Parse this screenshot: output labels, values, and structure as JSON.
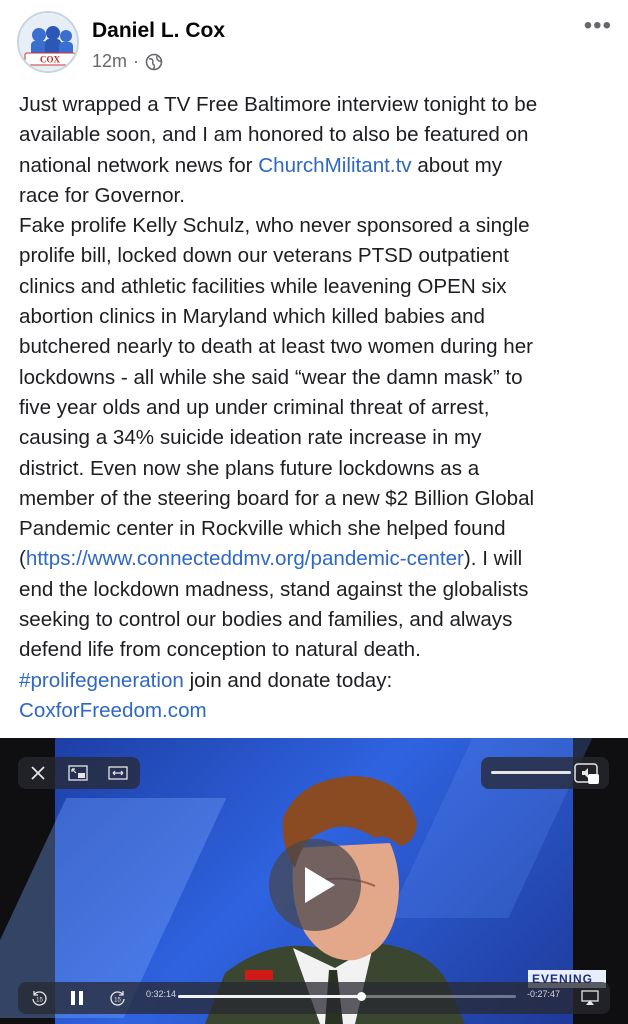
{
  "post": {
    "author": "Daniel L. Cox",
    "time": "12m",
    "visibility_icon": "globe-icon",
    "more_icon": "more-options-icon",
    "avatar_label": "COX",
    "lines": [
      [
        {
          "t": "Just wrapped a TV Free Baltimore interview tonight to be"
        }
      ],
      [
        {
          "t": "available soon, and I am honored to also be featured on"
        }
      ],
      [
        {
          "t": "national network news for "
        },
        {
          "t": "ChurchMilitant.tv",
          "link": true
        },
        {
          "t": " about my"
        }
      ],
      [
        {
          "t": "race for Governor."
        }
      ],
      [
        {
          "t": "Fake prolife Kelly Schulz, who never sponsored a single"
        }
      ],
      [
        {
          "t": "prolife bill, locked down our veterans PTSD outpatient"
        }
      ],
      [
        {
          "t": "clinics and athletic facilities while leavening OPEN six"
        }
      ],
      [
        {
          "t": "abortion clinics in Maryland which killed babies and"
        }
      ],
      [
        {
          "t": "butchered nearly to death at least two women during her"
        }
      ],
      [
        {
          "t": "lockdowns - all while she said “wear the damn mask” to"
        }
      ],
      [
        {
          "t": "five year olds and up under criminal threat of arrest,"
        }
      ],
      [
        {
          "t": "causing a 34% suicide ideation rate increase in my"
        }
      ],
      [
        {
          "t": "district. Even now she plans future lockdowns as a"
        }
      ],
      [
        {
          "t": "member of the steering board for a new $2 Billion Global"
        }
      ],
      [
        {
          "t": "Pandemic center in Rockville which she helped found"
        }
      ],
      [
        {
          "t": "("
        },
        {
          "t": "https://www.connecteddmv.org/pandemic-center",
          "link": true
        },
        {
          "t": ").  I will"
        }
      ],
      [
        {
          "t": "end the lockdown madness, stand against the globalists"
        }
      ],
      [
        {
          "t": "seeking to control our bodies and families, and always"
        }
      ],
      [
        {
          "t": "defend life from conception to natural death."
        }
      ],
      [
        {
          "t": "#prolifegeneration",
          "link": true
        },
        {
          "t": " join and donate today:"
        }
      ],
      [
        {
          "t": "CoxforFreedom.com",
          "link": true
        }
      ]
    ]
  },
  "video": {
    "elapsed": "0:32:14",
    "remaining": "-0:27:47",
    "progress": 0.54,
    "news_tag": "EVENING",
    "controls": {
      "close_icon": "close-icon",
      "pip_icon": "picture-in-picture-icon",
      "resize_icon": "resize-icon",
      "volume_icon": "volume-icon",
      "play_icon": "play-icon",
      "skip_back_icon": "skip-back-15-icon",
      "pause_icon": "pause-icon",
      "skip_forward_icon": "skip-forward-15-icon",
      "airplay_icon": "airplay-icon",
      "skip_back_label": "15",
      "skip_forward_label": "15"
    },
    "colors": {
      "link": "#2e68c5",
      "studio_blue": "#2f63e0",
      "news_red": "#d01a1a"
    }
  }
}
